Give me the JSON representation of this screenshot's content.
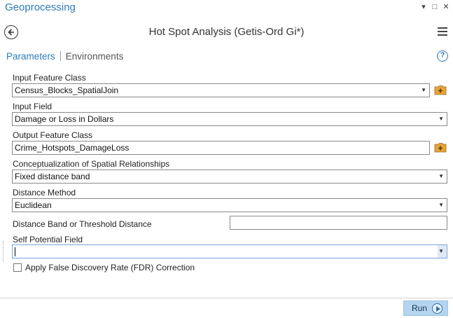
{
  "window": {
    "title": "Geoprocessing",
    "controls": {
      "pin": "▾",
      "maximize": "□",
      "close": "✕"
    }
  },
  "header": {
    "tool_title": "Hot Spot Analysis (Getis-Ord Gi*)",
    "back_icon": "back-arrow-icon",
    "menu_icon": "hamburger-menu-icon"
  },
  "tabs": {
    "parameters": "Parameters",
    "environments": "Environments",
    "help": "?"
  },
  "params": {
    "input_feature_class": {
      "label": "Input Feature Class",
      "value": "Census_Blocks_SpatialJoin"
    },
    "input_field": {
      "label": "Input Field",
      "value": "Damage or Loss in Dollars"
    },
    "output_feature_class": {
      "label": "Output Feature Class",
      "value": "Crime_Hotspots_DamageLoss"
    },
    "conceptualization": {
      "label": "Conceptualization of Spatial Relationships",
      "value": "Fixed distance band"
    },
    "distance_method": {
      "label": "Distance Method",
      "value": "Euclidean"
    },
    "distance_band": {
      "label": "Distance Band or Threshold Distance",
      "value": ""
    },
    "self_potential": {
      "label": "Self Potential Field",
      "value": ""
    },
    "fdr": {
      "label": "Apply False Discovery Rate (FDR) Correction",
      "checked": false
    }
  },
  "footer": {
    "run_label": "Run"
  },
  "colors": {
    "accent": "#2d7bbd",
    "run_button": "#b3d5ef",
    "folder_icon": "#e8a43a"
  },
  "caret_glyph": "▼"
}
